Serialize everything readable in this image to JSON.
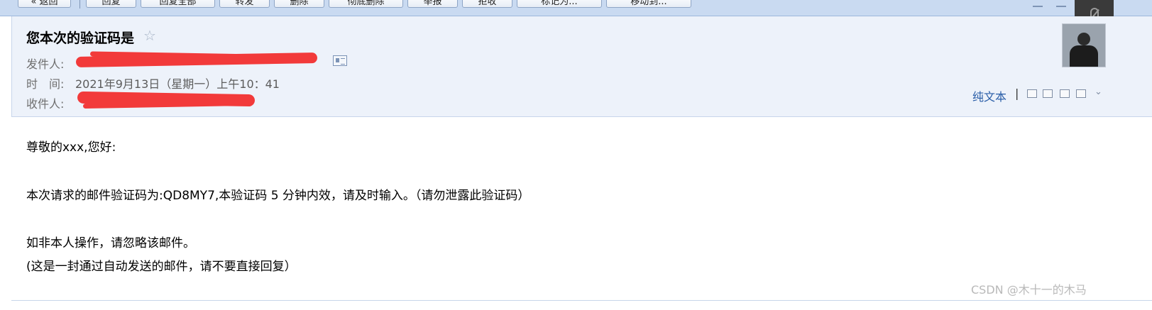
{
  "toolbar": {
    "buttons": [
      "« 返回",
      "回复",
      "回复全部",
      "转发",
      "删除",
      "彻底删除",
      "举报",
      "拒收",
      "标记为...",
      "移动到..."
    ]
  },
  "email": {
    "subject": "您本次的验证码是",
    "sender_label": "发件人:",
    "time_label": "时　间:",
    "time_value": "2021年9月13日（星期一）上午10：41",
    "recipient_label": "收件人:",
    "plain_text_link": "纯文本",
    "body": {
      "greeting": "尊敬的xxx,您好:",
      "line1": "本次请求的邮件验证码为:QD8MY7,本验证码 5 分钟内效，请及时输入。（请勿泄露此验证码）",
      "line2": "如非本人操作，请忽略该邮件。",
      "line3": "(这是一封通过自动发送的邮件，请不要直接回复）"
    }
  },
  "watermark": "CSDN @木十一的木马",
  "colors": {
    "redaction": "#f23a3a",
    "link": "#2a5ea8",
    "header_bg": "#edf2fa",
    "toolbar_bg": "#c9daf1"
  },
  "icons": [
    "star-icon",
    "contact-card-icon",
    "avatar",
    "new-window-icon",
    "note-icon",
    "save-icon",
    "print-icon",
    "chevron-down-icon",
    "mic-muted-icon"
  ]
}
